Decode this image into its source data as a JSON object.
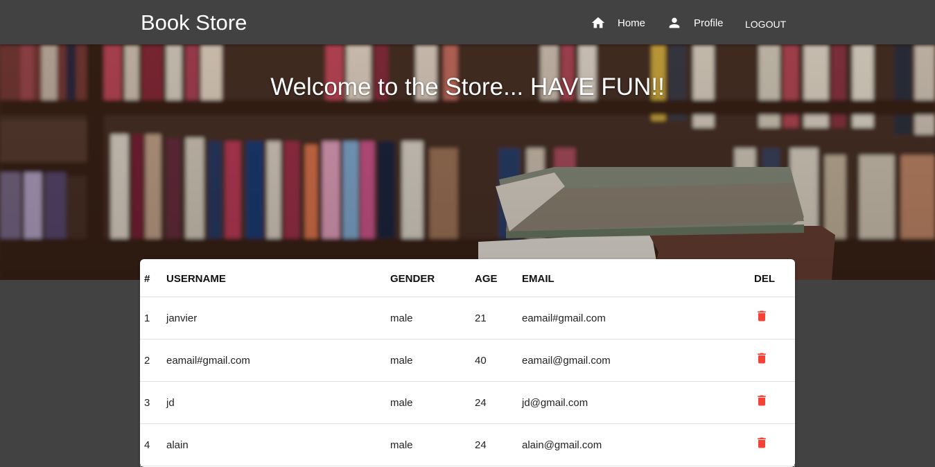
{
  "app": {
    "brand": "Book Store"
  },
  "nav": {
    "home_icon": "home-icon",
    "home": "Home",
    "profile_icon": "person-icon",
    "profile": "Profile",
    "logout": "LOGOUT"
  },
  "hero": {
    "title": "Welcome to the Store... HAVE FUN!!"
  },
  "table": {
    "headers": {
      "num": "#",
      "username": "USERNAME",
      "gender": "GENDER",
      "age": "AGE",
      "email": "EMAIL",
      "del": "DEL"
    },
    "rows": [
      {
        "num": "1",
        "username": "janvier",
        "gender": "male",
        "age": "21",
        "email": "eamail#gmail.com"
      },
      {
        "num": "2",
        "username": "eamail#gmail.com",
        "gender": "male",
        "age": "40",
        "email": "eamail@gmail.com"
      },
      {
        "num": "3",
        "username": "jd",
        "gender": "male",
        "age": "24",
        "email": "jd@gmail.com"
      },
      {
        "num": "4",
        "username": "alain",
        "gender": "male",
        "age": "24",
        "email": "alain@gmail.com"
      }
    ],
    "delete_icon": "trash-icon",
    "delete_color": "#f44336"
  },
  "colors": {
    "navbar": "#424242",
    "background": "#424242"
  }
}
